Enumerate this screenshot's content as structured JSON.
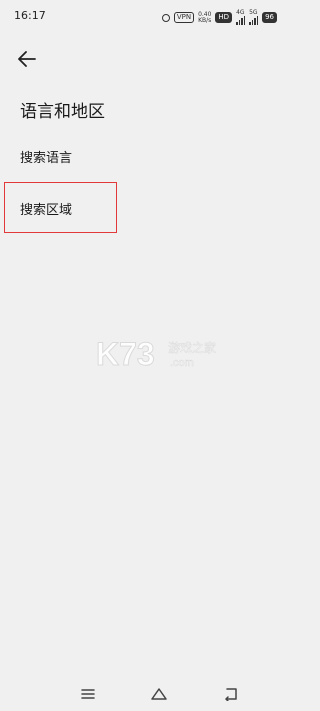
{
  "status_bar": {
    "time": "16:17",
    "vpn": "VPN",
    "speed_value": "0.40",
    "speed_unit": "KB/s",
    "hd": "HD",
    "net_4g": "4G",
    "net_5g": "5G",
    "battery": "96"
  },
  "header": {
    "back_icon": "arrow-left-icon",
    "title": "语言和地区"
  },
  "settings": {
    "items": [
      {
        "label": "搜索语言"
      },
      {
        "label": "搜索区域"
      }
    ]
  },
  "watermark": {
    "logo": "K73",
    "text": "游戏之家",
    "domain": ".com"
  },
  "nav": {
    "menu_icon": "menu-icon",
    "home_icon": "home-icon",
    "back_icon": "back-icon"
  },
  "colors": {
    "background": "#f0f0f0",
    "highlight": "#e23a3a",
    "text": "#1a1a1a"
  }
}
